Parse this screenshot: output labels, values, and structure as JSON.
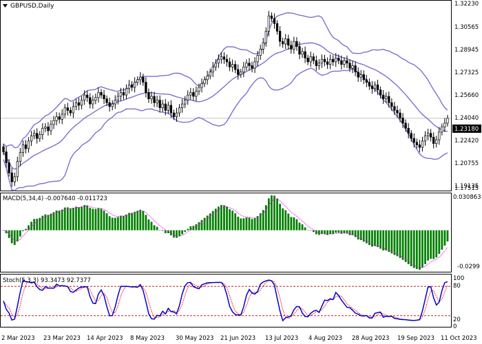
{
  "window": {
    "symbol_title": "GBPUSD,Daily",
    "collapse_icon": "triangle-down-icon"
  },
  "colors": {
    "bull": "#008000",
    "bear": "#000000",
    "bands": "#7b6fd0",
    "macd_bar": "#008000",
    "macd_signal": "#ff00ff",
    "stoch_main": "#0000c8",
    "stoch_signal": "#ff0000",
    "level_line": "#b00000",
    "grid": "#c0c0c0",
    "price_line": "#c0c0c0",
    "price_tag_bg": "#000000",
    "price_tag_text": "#ffffff"
  },
  "price_axis": {
    "ticks": [
      "1.32230",
      "1.30565",
      "1.28945",
      "1.27325",
      "1.25660",
      "1.24040",
      "1.22420",
      "1.20755",
      "1.19135",
      "1.17515"
    ],
    "current_price": "1.23180"
  },
  "macd": {
    "label": "MACD(5,34,4) -0.007640 -0.011723",
    "ticks": [
      "0.030863",
      "-0.0299"
    ]
  },
  "stoch": {
    "label": "Stoch(5,3,3) 93.3473 92.7377",
    "ticks": [
      "100",
      "80",
      "20",
      "0"
    ]
  },
  "time_axis": {
    "labels": [
      "2 Mar 2023",
      "23 Mar 2023",
      "14 Apr 2023",
      "8 May 2023",
      "30 May 2023",
      "21 Jun 2023",
      "13 Jul 2023",
      "4 Aug 2023",
      "28 Aug 2023",
      "19 Sep 2023",
      "11 Oct 2023"
    ]
  },
  "chart_data": {
    "type": "candlestick",
    "symbol": "GBPUSD",
    "timeframe": "Daily",
    "y_range": [
      1.17515,
      1.3223
    ],
    "close": [
      1.2055,
      1.197,
      1.189,
      1.182,
      1.186,
      1.198,
      1.205,
      1.211,
      1.208,
      1.214,
      1.218,
      1.22,
      1.216,
      1.219,
      1.224,
      1.225,
      1.222,
      1.227,
      1.23,
      1.233,
      1.231,
      1.235,
      1.24,
      1.238,
      1.236,
      1.241,
      1.244,
      1.242,
      1.246,
      1.25,
      1.248,
      1.243,
      1.246,
      1.248,
      1.252,
      1.25,
      1.247,
      1.244,
      1.241,
      1.243,
      1.246,
      1.249,
      1.252,
      1.25,
      1.255,
      1.258,
      1.256,
      1.26,
      1.262,
      1.264,
      1.26,
      1.252,
      1.247,
      1.249,
      1.244,
      1.246,
      1.24,
      1.243,
      1.238,
      1.242,
      1.236,
      1.233,
      1.236,
      1.24,
      1.243,
      1.246,
      1.25,
      1.252,
      1.249,
      1.253,
      1.256,
      1.259,
      1.262,
      1.265,
      1.268,
      1.272,
      1.275,
      1.278,
      1.28,
      1.278,
      1.276,
      1.272,
      1.274,
      1.27,
      1.266,
      1.268,
      1.272,
      1.275,
      1.273,
      1.271,
      1.276,
      1.281,
      1.286,
      1.291,
      1.3,
      1.312,
      1.31,
      1.306,
      1.3,
      1.292,
      1.29,
      1.294,
      1.289,
      1.286,
      1.292,
      1.288,
      1.282,
      1.284,
      1.279,
      1.276,
      1.28,
      1.277,
      1.273,
      1.275,
      1.278,
      1.276,
      1.274,
      1.278,
      1.276,
      1.279,
      1.277,
      1.274,
      1.277,
      1.275,
      1.271,
      1.273,
      1.268,
      1.264,
      1.266,
      1.262,
      1.26,
      1.257,
      1.255,
      1.258,
      1.254,
      1.25,
      1.247,
      1.249,
      1.244,
      1.241,
      1.238,
      1.236,
      1.232,
      1.228,
      1.224,
      1.22,
      1.216,
      1.213,
      1.211,
      1.209,
      1.214,
      1.218,
      1.22,
      1.217,
      1.212,
      1.215,
      1.221,
      1.225,
      1.228,
      1.2318
    ]
  }
}
